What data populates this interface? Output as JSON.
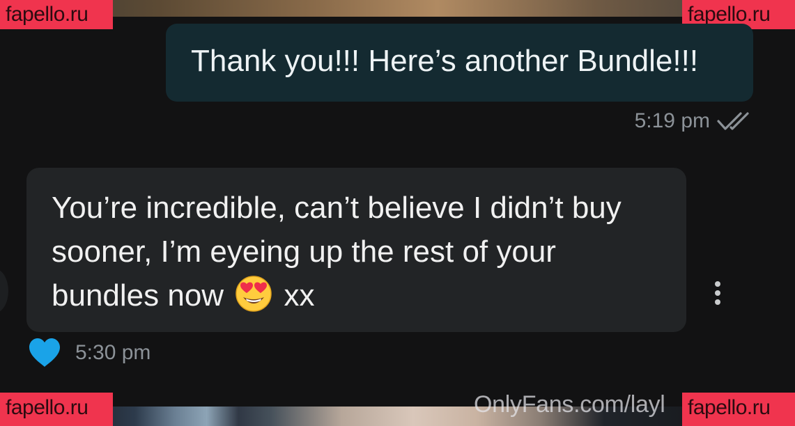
{
  "watermarks": {
    "top_left": "fapello.ru",
    "top_right": "fapello.ru",
    "bottom_left": "fapello.ru",
    "bottom_right": "fapello.ru"
  },
  "footer_watermark": "OnlyFans.com/layl",
  "messages": [
    {
      "direction": "outgoing",
      "text": "Thank you!!! Here’s another Bundle!!!",
      "time": "5:19 pm",
      "status_icon": "double-check-icon"
    },
    {
      "direction": "incoming",
      "lines": [
        "You’re incredible, can’t believe I didn’t buy",
        "sooner, I’m eyeing up the rest of your",
        "bundles now"
      ],
      "suffix": "xx",
      "emoji": "heart-eyes-emoji",
      "time": "5:30 pm",
      "reaction_icon": "blue-heart-icon",
      "menu_icon": "more-vertical-icon"
    }
  ],
  "colors": {
    "background": "#121213",
    "outgoing_bubble": "#142a31",
    "incoming_bubble": "#222426",
    "timestamp": "#8c9298",
    "heart": "#1aa3e8",
    "watermark": "#f0344e"
  }
}
